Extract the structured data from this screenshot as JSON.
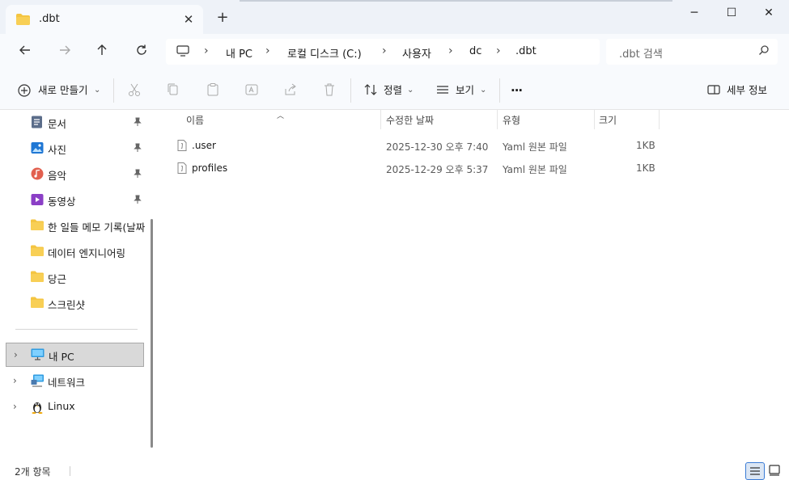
{
  "window": {
    "tab_title": ".dbt",
    "tab_close_glyph": "✕",
    "new_tab_glyph": "+",
    "minimize_glyph": "─",
    "maximize_glyph": "☐",
    "close_glyph": "✕"
  },
  "address": {
    "breadcrumbs": [
      "내 PC",
      "로컬 디스크 (C:)",
      "사용자",
      "dc",
      ".dbt"
    ],
    "separator": "›",
    "search_placeholder": ".dbt 검색"
  },
  "toolbar": {
    "new_label": "새로 만들기",
    "sort_label": "정렬",
    "view_label": "보기",
    "more_label": "···",
    "details_label": "세부 정보",
    "dropdown_glyph": "⌄"
  },
  "sidebar": {
    "pinned": [
      {
        "label": "문서",
        "icon": "document-icon"
      },
      {
        "label": "사진",
        "icon": "pictures-icon"
      },
      {
        "label": "음악",
        "icon": "music-icon"
      },
      {
        "label": "동영상",
        "icon": "videos-icon"
      }
    ],
    "folders": [
      "한 일들 메모 기록(날짜",
      "데이터 엔지니어링",
      "당근",
      "스크린샷"
    ],
    "bottom": [
      {
        "label": "내 PC",
        "icon": "this-pc-icon"
      },
      {
        "label": "네트워크",
        "icon": "network-icon"
      },
      {
        "label": "Linux",
        "icon": "linux-icon"
      }
    ],
    "expand_glyph": "›"
  },
  "columns": {
    "name": "이름",
    "modified": "수정한 날짜",
    "type": "유형",
    "size": "크기",
    "sort_glyph": "︿"
  },
  "files": [
    {
      "name": ".user",
      "modified": "2025-12-30 오후 7:40",
      "type": "Yaml 원본 파일",
      "size": "1KB"
    },
    {
      "name": "profiles",
      "modified": "2025-12-29 오후 5:37",
      "type": "Yaml 원본 파일",
      "size": "1KB"
    }
  ],
  "status": {
    "item_count": "2개 항목"
  },
  "colors": {
    "accent": "#3a7bd5",
    "folder": "#f4c542",
    "chrome_bg": "#eef2f8"
  }
}
